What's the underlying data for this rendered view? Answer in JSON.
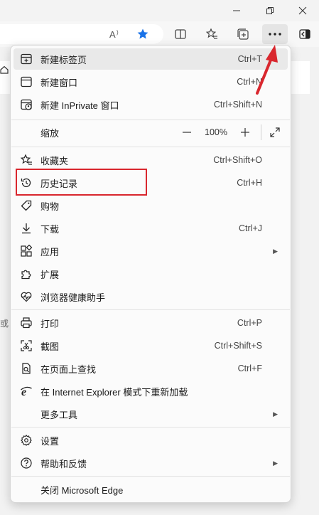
{
  "toolbar": {
    "zoom_value": "100%"
  },
  "menu": {
    "items": [
      {
        "label": "新建标签页",
        "shortcut": "Ctrl+T"
      },
      {
        "label": "新建窗口",
        "shortcut": "Ctrl+N"
      },
      {
        "label": "新建 InPrivate 窗口",
        "shortcut": "Ctrl+Shift+N"
      },
      {
        "label": "缩放",
        "shortcut": ""
      },
      {
        "label": "收藏夹",
        "shortcut": "Ctrl+Shift+O"
      },
      {
        "label": "历史记录",
        "shortcut": "Ctrl+H"
      },
      {
        "label": "购物",
        "shortcut": ""
      },
      {
        "label": "下载",
        "shortcut": "Ctrl+J"
      },
      {
        "label": "应用",
        "shortcut": ""
      },
      {
        "label": "扩展",
        "shortcut": ""
      },
      {
        "label": "浏览器健康助手",
        "shortcut": ""
      },
      {
        "label": "打印",
        "shortcut": "Ctrl+P"
      },
      {
        "label": "截图",
        "shortcut": "Ctrl+Shift+S"
      },
      {
        "label": "在页面上查找",
        "shortcut": "Ctrl+F"
      },
      {
        "label": "在 Internet Explorer 模式下重新加载",
        "shortcut": ""
      },
      {
        "label": "更多工具",
        "shortcut": ""
      },
      {
        "label": "设置",
        "shortcut": ""
      },
      {
        "label": "帮助和反馈",
        "shortcut": ""
      },
      {
        "label": "关闭 Microsoft Edge",
        "shortcut": ""
      }
    ]
  },
  "page_bg": {
    "edge_char": "或"
  },
  "colors": {
    "accent": "#1a73e8",
    "annotation": "#d9272e"
  }
}
